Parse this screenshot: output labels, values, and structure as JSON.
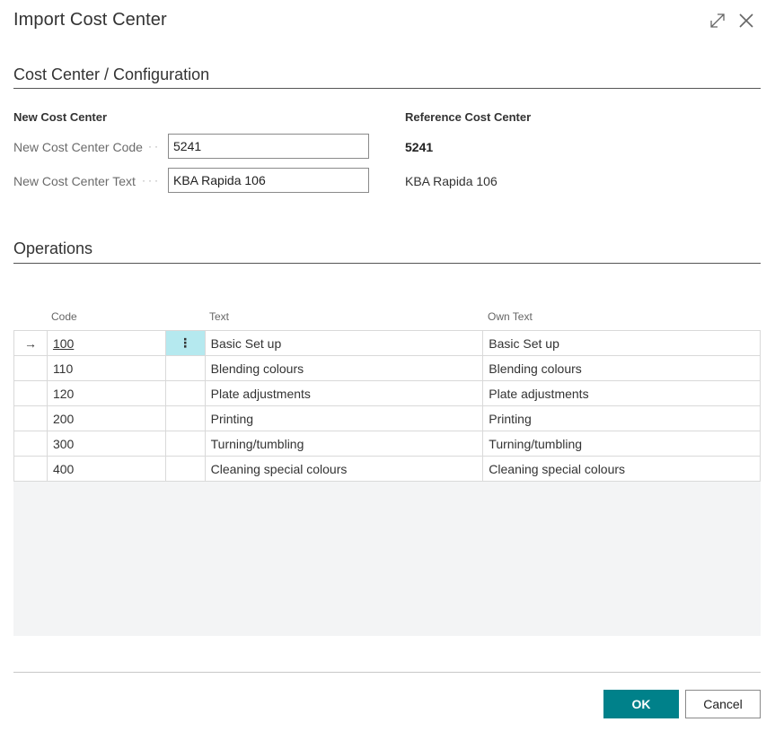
{
  "dialog": {
    "title": "Import Cost Center",
    "expand_icon": "expand-icon",
    "close_icon": "close-icon"
  },
  "config_section": {
    "title": "Cost Center / Configuration",
    "new_group": {
      "label": "New Cost Center",
      "code_label": "New Cost Center Code",
      "code_value": "5241",
      "text_label": "New Cost Center Text",
      "text_value": "KBA Rapida 106"
    },
    "reference_group": {
      "label": "Reference Cost Center",
      "code": "5241",
      "text": "KBA Rapida 106"
    }
  },
  "operations": {
    "title": "Operations",
    "columns": {
      "code": "Code",
      "text": "Text",
      "own_text": "Own Text"
    },
    "rows": [
      {
        "code": "100",
        "text": "Basic Set up",
        "own_text": "Basic Set up"
      },
      {
        "code": "110",
        "text": "Blending colours",
        "own_text": "Blending colours"
      },
      {
        "code": "120",
        "text": "Plate adjustments",
        "own_text": "Plate adjustments"
      },
      {
        "code": "200",
        "text": "Printing",
        "own_text": "Printing"
      },
      {
        "code": "300",
        "text": "Turning/tumbling",
        "own_text": "Turning/tumbling"
      },
      {
        "code": "400",
        "text": "Cleaning special colours",
        "own_text": "Cleaning special colours"
      }
    ],
    "row_marker": "→",
    "row_menu": "⋮"
  },
  "footer": {
    "ok_label": "OK",
    "cancel_label": "Cancel"
  },
  "colors": {
    "accent": "#00818a",
    "selected_cell": "#b5e9ef",
    "grid_background": "#f3f4f5"
  }
}
